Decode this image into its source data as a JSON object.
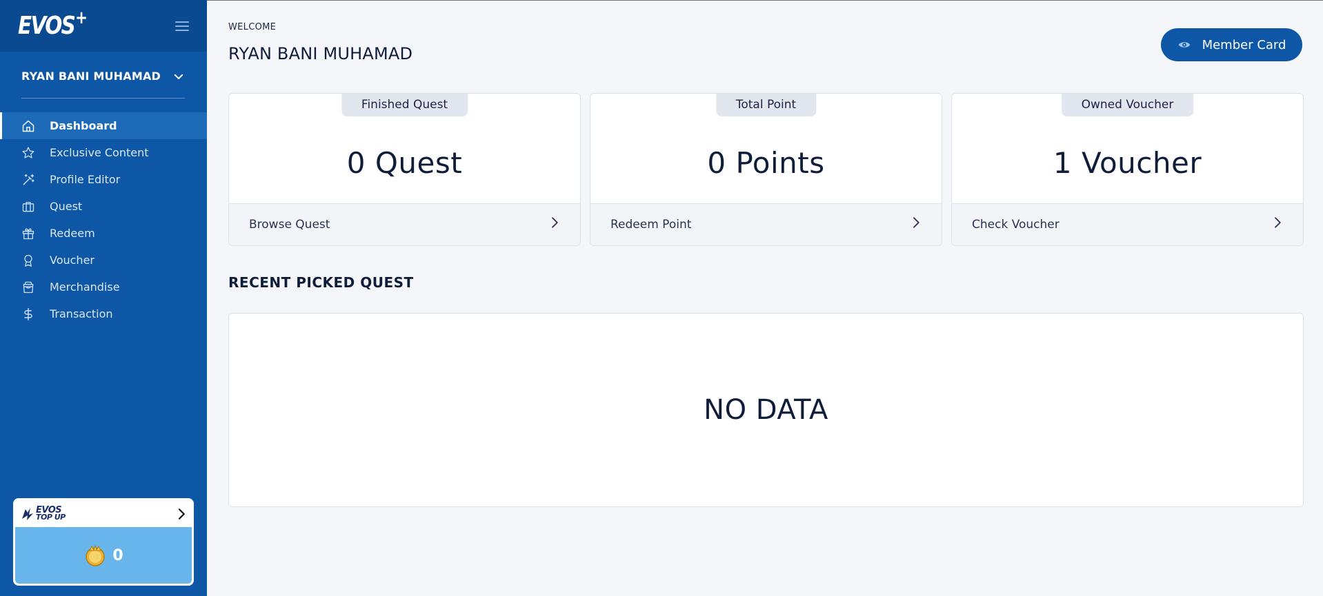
{
  "sidebar": {
    "logo": "EVOS",
    "logo_plus": "+",
    "user_name": "RYAN BANI MUHAMAD",
    "items": [
      {
        "label": "Dashboard",
        "icon": "home-icon",
        "active": true
      },
      {
        "label": "Exclusive Content",
        "icon": "star-icon",
        "active": false
      },
      {
        "label": "Profile Editor",
        "icon": "magic-wand-icon",
        "active": false
      },
      {
        "label": "Quest",
        "icon": "briefcase-icon",
        "active": false
      },
      {
        "label": "Redeem",
        "icon": "gift-icon",
        "active": false
      },
      {
        "label": "Voucher",
        "icon": "award-icon",
        "active": false
      },
      {
        "label": "Merchandise",
        "icon": "shopping-bag-icon",
        "active": false
      },
      {
        "label": "Transaction",
        "icon": "dollar-icon",
        "active": false
      }
    ],
    "topup": {
      "logo_line1": "EVOS",
      "logo_line2": "TOP UP",
      "coin_value": "0"
    }
  },
  "header": {
    "welcome": "WELCOME",
    "title": "RYAN BANI MUHAMAD",
    "member_card_label": "Member Card"
  },
  "stats": [
    {
      "tab": "Finished Quest",
      "value": "0 Quest",
      "action": "Browse Quest"
    },
    {
      "tab": "Total Point",
      "value": "0 Points",
      "action": "Redeem Point"
    },
    {
      "tab": "Owned Voucher",
      "value": "1 Voucher",
      "action": "Check Voucher"
    }
  ],
  "recent": {
    "title": "RECENT PICKED QUEST",
    "empty_text": "NO DATA"
  },
  "colors": {
    "sidebar_bg": "#0d57a6",
    "sidebar_top": "#0a4a91",
    "active_item": "#1c6ab8",
    "topup_body": "#67b5eb",
    "page_bg": "#f4f6fa"
  }
}
